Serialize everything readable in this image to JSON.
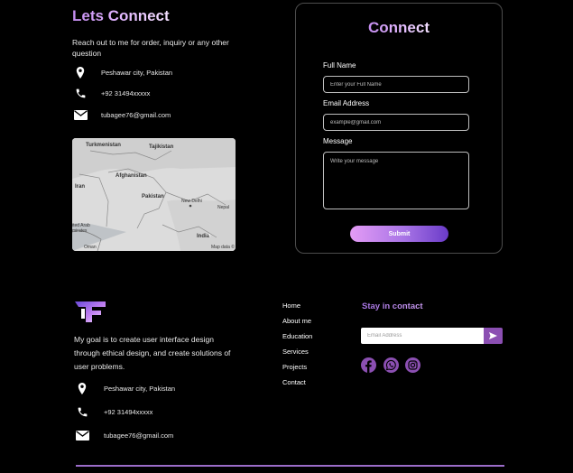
{
  "contact": {
    "heading": "Lets Connect",
    "intro": "Reach out to me for order, inquiry or any other question",
    "location": "Peshawar city, Pakistan",
    "phone": "+92 31494xxxxx",
    "email": "tubagee76@gmail.com"
  },
  "map": {
    "labels": [
      "Turkmenistan",
      "Tajikistan",
      "Afghanistan",
      "Iran",
      "Pakistan",
      "New Delhi",
      "Nepal",
      "India",
      "ited Arab mirates",
      "Oman",
      "Map data ©"
    ]
  },
  "form": {
    "title": "Connect",
    "full_name_label": "Full Name",
    "full_name_placeholder": "Enter your Full Name",
    "email_label": "Email Address",
    "email_placeholder": "example@gmail.com",
    "message_label": "Message",
    "message_placeholder": "Write your message",
    "submit_label": "Submit"
  },
  "footer": {
    "logo_letter": "F",
    "mission": "My goal is to create user interface design through ethical design, and create solutions of user problems.",
    "location": "Peshawar city, Pakistan",
    "phone": "+92 31494xxxxx",
    "email": "tubagee76@gmail.com",
    "nav": [
      "Home",
      "About me",
      "Education",
      "Services",
      "Projects",
      "Contact"
    ],
    "stay_heading": "Stay in contact",
    "newsletter_placeholder": "Email Address",
    "social": [
      "facebook-icon",
      "whatsapp-icon",
      "instagram-icon"
    ]
  },
  "colors": {
    "accent": "#9b6cc9",
    "accent_dark": "#8b4fb2",
    "background": "#000000"
  }
}
